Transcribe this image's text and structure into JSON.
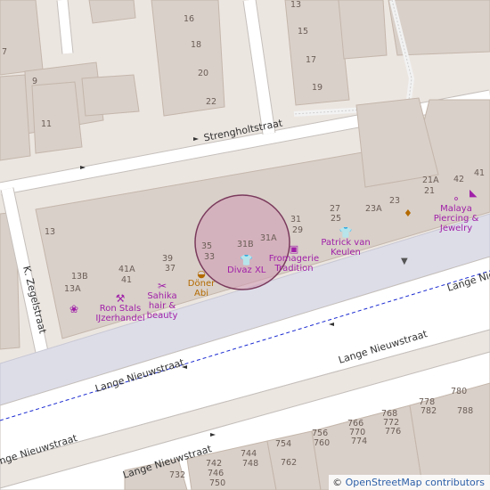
{
  "map": {
    "colors": {
      "background": "#ece6e1",
      "building": "#d9d0c9",
      "building_outline": "#c4b6ab",
      "road": "#ffffff",
      "road_casing": "#c5bfbb",
      "pedestrian": "#dddde8",
      "bus_route": "#1a2ad1",
      "poi": "#a020a8",
      "highlight_fill": "#d09fb5",
      "highlight_stroke": "#7a3a5c"
    },
    "streets": [
      {
        "name": "Strengholtstraat"
      },
      {
        "name": "K. Zegelstraat"
      },
      {
        "name": "Lange Nieuwstraat"
      },
      {
        "name": "Lange Nieuwstraat"
      },
      {
        "name": "Lange Nieuwstraat"
      },
      {
        "name": "Lange Nieuwstraat"
      },
      {
        "name": "Lange Nieuwstraat"
      }
    ],
    "house_numbers": [
      "13",
      "15",
      "17",
      "19",
      "16",
      "18",
      "20",
      "22",
      "7",
      "9",
      "11",
      "13",
      "35",
      "33",
      "31B",
      "31A",
      "31",
      "29",
      "27",
      "25",
      "23A",
      "23",
      "21A",
      "21",
      "42",
      "41",
      "13B",
      "13A",
      "41A",
      "41",
      "39",
      "37",
      "780",
      "778",
      "782",
      "788",
      "768",
      "772",
      "776",
      "766",
      "770",
      "774",
      "756",
      "760",
      "754",
      "744",
      "748",
      "762",
      "742",
      "746",
      "750",
      "732"
    ],
    "pois": [
      {
        "name": "Divaz XL",
        "icon": "shirt-icon"
      },
      {
        "name": "Fromagerie Tradition",
        "icon": "cheese-shop-icon"
      },
      {
        "name": "Patrick van Keulen",
        "icon": "shirt-icon"
      },
      {
        "name": "Malaya Piercing & Jewelry",
        "icon": "ring-icon"
      },
      {
        "name": "Ron Stals IJzerhandel",
        "icon": "hardware-icon"
      },
      {
        "name": "Sahika hair & beauty",
        "icon": "hairdresser-icon"
      },
      {
        "name": "Döner Abi",
        "icon": "fast-food-icon"
      },
      {
        "name": "",
        "icon": "florist-icon"
      },
      {
        "name": "",
        "icon": "shoe-icon"
      },
      {
        "name": "",
        "icon": "jewelry-icon"
      },
      {
        "name": "",
        "icon": "waste-basket-icon"
      }
    ],
    "attribution": {
      "symbol": "©",
      "text": "OpenStreetMap contributors"
    }
  }
}
